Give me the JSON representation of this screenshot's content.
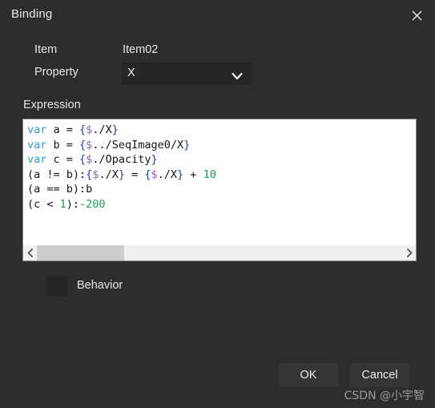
{
  "window": {
    "title": "Binding",
    "close_icon": "close-icon",
    "background_color": "#2d2d2d"
  },
  "form": {
    "item": {
      "label": "Item",
      "value": "Item02"
    },
    "property": {
      "label": "Property",
      "value": "X",
      "arrow_icon": "chevron-down-icon"
    }
  },
  "expression": {
    "label": "Expression",
    "lines": [
      {
        "id": "line-1",
        "tokens": [
          {
            "text": "var",
            "type": "kw"
          },
          {
            "text": " a = ",
            "type": "plain"
          },
          {
            "text": "{",
            "type": "brace"
          },
          {
            "text": "$",
            "type": "dollar"
          },
          {
            "text": "./X",
            "type": "plain"
          },
          {
            "text": "}",
            "type": "brace"
          }
        ],
        "plain": "var a = {$./X}"
      },
      {
        "id": "line-2",
        "tokens": [
          {
            "text": "var",
            "type": "kw"
          },
          {
            "text": " b = ",
            "type": "plain"
          },
          {
            "text": "{",
            "type": "brace"
          },
          {
            "text": "$",
            "type": "dollar"
          },
          {
            "text": "../SeqImage0/X",
            "type": "plain"
          },
          {
            "text": "}",
            "type": "brace"
          }
        ],
        "plain": "var b = {$../SeqImage0/X}"
      },
      {
        "id": "line-3",
        "tokens": [
          {
            "text": "var",
            "type": "kw"
          },
          {
            "text": " c = ",
            "type": "plain"
          },
          {
            "text": "{",
            "type": "brace"
          },
          {
            "text": "$",
            "type": "dollar"
          },
          {
            "text": "./Opacity",
            "type": "plain"
          },
          {
            "text": "}",
            "type": "brace"
          }
        ],
        "plain": "var c = {$./Opacity}"
      },
      {
        "id": "line-4",
        "tokens": [
          {
            "text": "(a != b):",
            "type": "plain"
          },
          {
            "text": "{",
            "type": "brace"
          },
          {
            "text": "$",
            "type": "dollar"
          },
          {
            "text": "./X",
            "type": "plain"
          },
          {
            "text": "}",
            "type": "brace"
          },
          {
            "text": " = ",
            "type": "plain"
          },
          {
            "text": "{",
            "type": "brace"
          },
          {
            "text": "$",
            "type": "dollar"
          },
          {
            "text": "./X",
            "type": "plain"
          },
          {
            "text": "}",
            "type": "brace"
          },
          {
            "text": " + ",
            "type": "plain"
          },
          {
            "text": "10",
            "type": "num"
          }
        ],
        "plain": "(a != b):{$./X} = {$./X} + 10"
      },
      {
        "id": "line-5",
        "tokens": [
          {
            "text": "(a == b):b",
            "type": "plain"
          }
        ],
        "plain": "(a == b):b"
      },
      {
        "id": "line-6",
        "tokens": [
          {
            "text": "(c < ",
            "type": "plain"
          },
          {
            "text": "1",
            "type": "num"
          },
          {
            "text": "):",
            "type": "plain"
          },
          {
            "text": "-200",
            "type": "num"
          }
        ],
        "plain": "(c < 1):-200"
      }
    ],
    "scrollbar": {
      "left_arrow_icon": "chevron-left-icon",
      "right_arrow_icon": "chevron-right-icon",
      "thumb_position_percent": 0,
      "thumb_width_percent": 24
    },
    "syntax_colors": {
      "keyword": "#2f9bd8",
      "dollar": "#9b59c6",
      "brace": "#1a3fa0",
      "number": "#17a84a",
      "plain": "#141414",
      "editor_background": "#ffffff"
    }
  },
  "behavior": {
    "label": "Behavior",
    "checked": false
  },
  "footer": {
    "ok_label": "OK",
    "cancel_label": "Cancel"
  },
  "watermark": {
    "text": "CSDN @小宇智"
  }
}
